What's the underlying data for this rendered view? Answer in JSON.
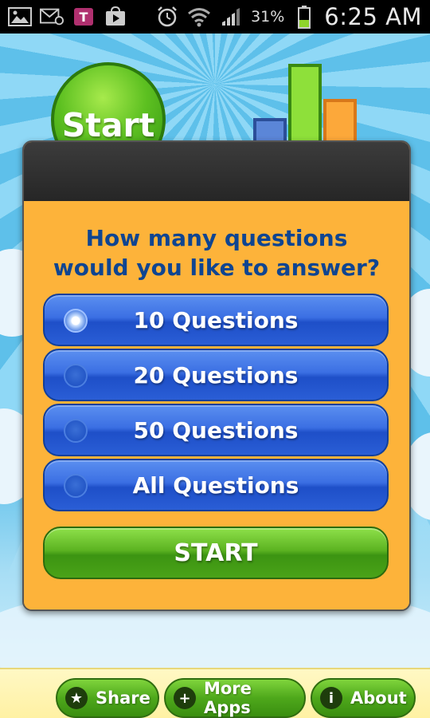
{
  "status_bar": {
    "battery_percent": "31%",
    "time": "6:25 AM"
  },
  "hero": {
    "badge_text": "Start"
  },
  "dialog": {
    "question": "How many questions would you like to answer?",
    "options": [
      {
        "label": "10 Questions",
        "selected": true
      },
      {
        "label": "20 Questions",
        "selected": false
      },
      {
        "label": "50 Questions",
        "selected": false
      },
      {
        "label": "All Questions",
        "selected": false
      }
    ],
    "start_label": "START"
  },
  "bottom_bar": {
    "share_label": "Share",
    "more_apps_label": "More Apps",
    "about_label": "About"
  },
  "colors": {
    "dialog_bg": "#fdb33a",
    "option_blue": "#2a5ed6",
    "start_green": "#4aa318",
    "question_text": "#0f4591"
  }
}
